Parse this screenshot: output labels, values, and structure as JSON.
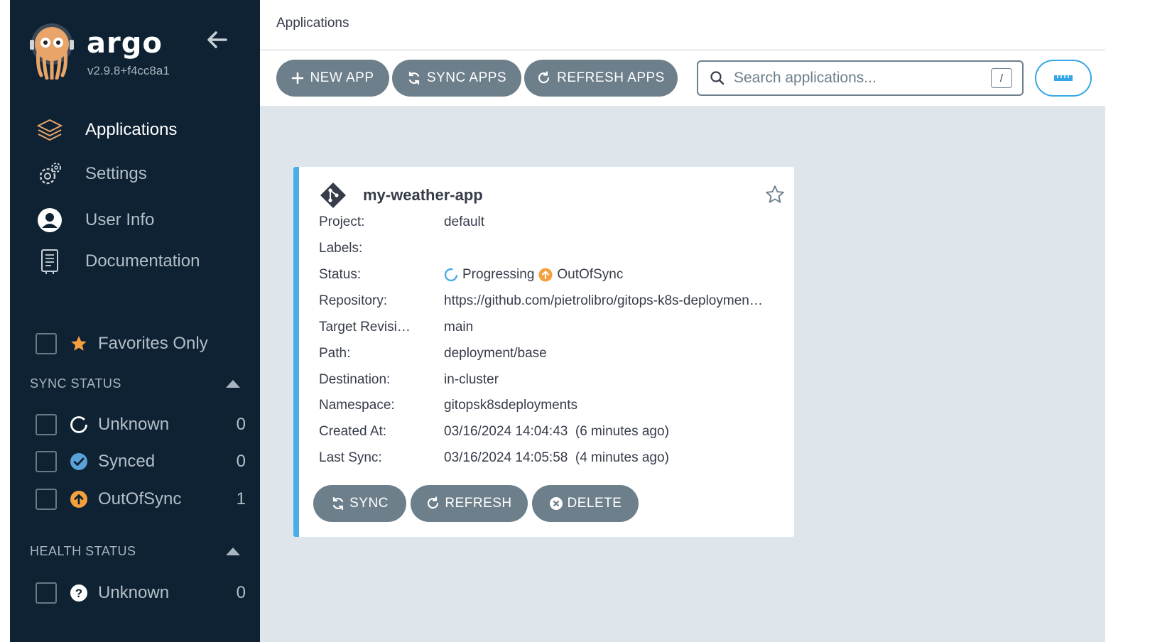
{
  "sidebar": {
    "brand": "argo",
    "version": "v2.9.8+f4cc8a1",
    "nav": [
      {
        "label": "Applications",
        "icon": "layers-icon",
        "active": true
      },
      {
        "label": "Settings",
        "icon": "gears-icon",
        "active": false
      },
      {
        "label": "User Info",
        "icon": "user-circle-icon",
        "active": false
      },
      {
        "label": "Documentation",
        "icon": "book-icon",
        "active": false
      }
    ],
    "favorites_label": "Favorites Only",
    "sync_status": {
      "title": "SYNC STATUS",
      "items": [
        {
          "label": "Unknown",
          "count": "0",
          "icon": "circle-notch-icon"
        },
        {
          "label": "Synced",
          "count": "0",
          "icon": "check-circle-icon"
        },
        {
          "label": "OutOfSync",
          "count": "1",
          "icon": "arrow-up-circle-icon"
        }
      ]
    },
    "health_status": {
      "title": "HEALTH STATUS",
      "items": [
        {
          "label": "Unknown",
          "count": "0",
          "icon": "question-circle-icon"
        }
      ]
    }
  },
  "header": {
    "title": "Applications"
  },
  "toolbar": {
    "new_app": "NEW APP",
    "sync_apps": "SYNC APPS",
    "refresh_apps": "REFRESH APPS",
    "search_placeholder": "Search applications...",
    "search_shortcut": "/"
  },
  "app": {
    "name": "my-weather-app",
    "fields": {
      "project_label": "Project:",
      "project": "default",
      "labels_label": "Labels:",
      "labels": "",
      "status_label": "Status:",
      "health": "Progressing",
      "sync": "OutOfSync",
      "repo_label": "Repository:",
      "repo": "https://github.com/pietrolibro/gitops-k8s-deploymen…",
      "revision_label": "Target Revisi…",
      "revision": "main",
      "path_label": "Path:",
      "path": "deployment/base",
      "dest_label": "Destination:",
      "dest": "in-cluster",
      "ns_label": "Namespace:",
      "ns": "gitopsk8sdeployments",
      "created_label": "Created At:",
      "created": "03/16/2024 14:04:43  (6 minutes ago)",
      "lastsync_label": "Last Sync:",
      "lastsync": "03/16/2024 14:05:58  (4 minutes ago)"
    },
    "buttons": {
      "sync": "SYNC",
      "refresh": "REFRESH",
      "delete": "DELETE"
    }
  },
  "colors": {
    "sidebar_bg": "#0e2233",
    "accent_blue": "#4aaee6",
    "button_gray": "#6d7f8b",
    "outofsync_orange": "#f4a03c",
    "content_bg": "#dee6eb"
  }
}
